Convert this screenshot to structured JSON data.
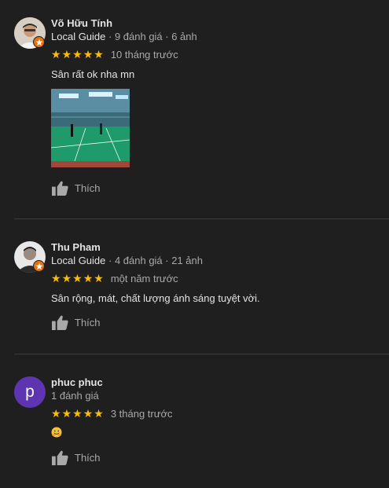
{
  "reviews": [
    {
      "author": "Võ Hữu Tính",
      "local_guide": "Local Guide",
      "stats": " · 9 đánh giá · 6 ảnh",
      "rating": 5,
      "time": "10 tháng trước",
      "text": "Sân rất ok nha mn",
      "like_label": "Thích",
      "avatar_icon": "person-photo-avatar",
      "badge_icon": "local-guide-star-badge"
    },
    {
      "author": "Thu Pham",
      "local_guide": "Local Guide",
      "stats": " · 4 đánh giá · 21 ảnh",
      "rating": 5,
      "time": "một năm trước",
      "text": "Sân rộng, mát, chất lượng ánh sáng tuyệt vời.",
      "like_label": "Thích",
      "avatar_icon": "person-photo-avatar",
      "badge_icon": "local-guide-star-badge"
    },
    {
      "author": "phuc phuc",
      "local_guide": "",
      "stats": "1 đánh giá",
      "rating": 5,
      "time": "3 tháng trước",
      "text": "🤗",
      "like_label": "Thích",
      "avatar_letter": "p",
      "avatar_color": "#5e35b1"
    }
  ],
  "colors": {
    "background": "#1f1f1f",
    "star": "#fbbc04",
    "badge": "#e8710a",
    "secondary_text": "#a9a9a9"
  }
}
